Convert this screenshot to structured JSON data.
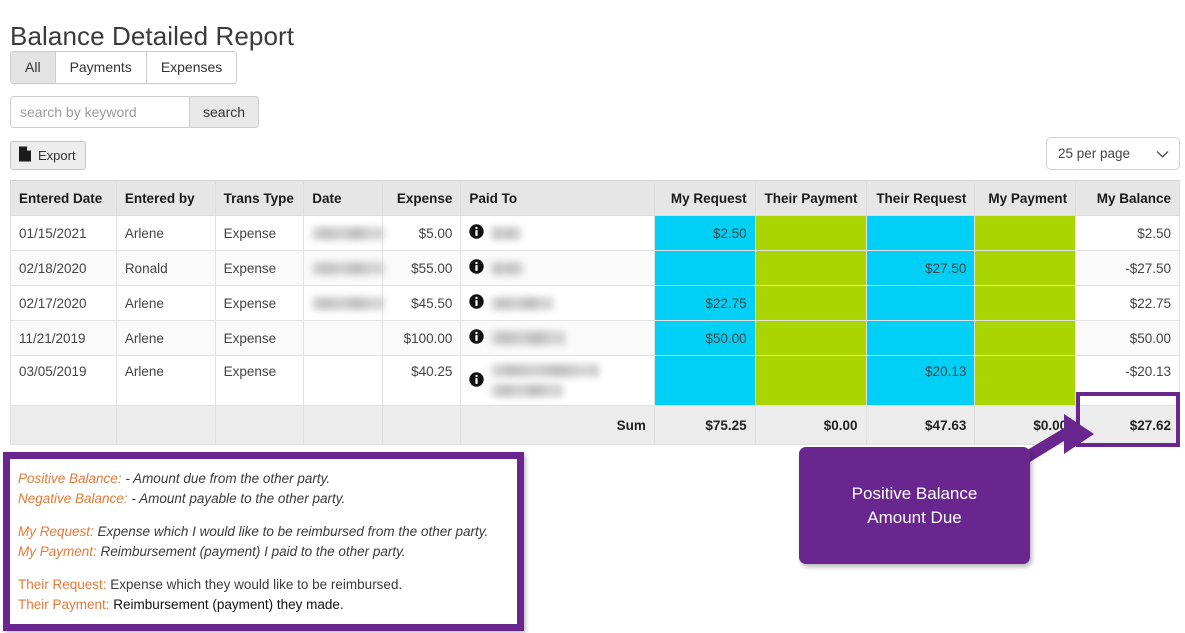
{
  "page": {
    "title": "Balance Detailed Report"
  },
  "tabs": [
    {
      "label": "All",
      "active": true
    },
    {
      "label": "Payments",
      "active": false
    },
    {
      "label": "Expenses",
      "active": false
    }
  ],
  "search": {
    "placeholder": "search by keyword",
    "value": "",
    "button_label": "search"
  },
  "toolbar": {
    "export_label": "Export",
    "export_icon": "document-icon"
  },
  "per_page": {
    "selected": "25 per page",
    "chevron_icon": "chevron-down-icon"
  },
  "table": {
    "columns": [
      {
        "key": "entered_date",
        "label": "Entered Date",
        "align": "left"
      },
      {
        "key": "entered_by",
        "label": "Entered by",
        "align": "left"
      },
      {
        "key": "trans_type",
        "label": "Trans Type",
        "align": "left"
      },
      {
        "key": "date",
        "label": "Date",
        "align": "left"
      },
      {
        "key": "expense",
        "label": "Expense",
        "align": "right"
      },
      {
        "key": "paid_to",
        "label": "Paid To",
        "align": "left"
      },
      {
        "key": "my_request",
        "label": "My Request",
        "align": "right"
      },
      {
        "key": "their_payment",
        "label": "Their Payment",
        "align": "right"
      },
      {
        "key": "their_request",
        "label": "Their Request",
        "align": "right"
      },
      {
        "key": "my_payment",
        "label": "My Payment",
        "align": "right"
      },
      {
        "key": "my_balance",
        "label": "My Balance",
        "align": "right"
      }
    ],
    "rows": [
      {
        "entered_date": "01/15/2021",
        "entered_by": "Arlene",
        "trans_type": "Expense",
        "date": "",
        "expense": "$5.00",
        "paid_to": "",
        "my_request": "$2.50",
        "their_payment": "",
        "their_request": "",
        "my_payment": "",
        "my_balance": "$2.50"
      },
      {
        "entered_date": "02/18/2020",
        "entered_by": "Ronald",
        "trans_type": "Expense",
        "date": "",
        "expense": "$55.00",
        "paid_to": "",
        "my_request": "",
        "their_payment": "",
        "their_request": "$27.50",
        "my_payment": "",
        "my_balance": "-$27.50"
      },
      {
        "entered_date": "02/17/2020",
        "entered_by": "Arlene",
        "trans_type": "Expense",
        "date": "",
        "expense": "$45.50",
        "paid_to": "",
        "my_request": "$22.75",
        "their_payment": "",
        "their_request": "",
        "my_payment": "",
        "my_balance": "$22.75"
      },
      {
        "entered_date": "11/21/2019",
        "entered_by": "Arlene",
        "trans_type": "Expense",
        "date": "",
        "expense": "$100.00",
        "paid_to": "",
        "my_request": "$50.00",
        "their_payment": "",
        "their_request": "",
        "my_payment": "",
        "my_balance": "$50.00"
      },
      {
        "entered_date": "03/05/2019",
        "entered_by": "Arlene",
        "trans_type": "Expense",
        "date": "",
        "expense": "$40.25",
        "paid_to": "",
        "my_request": "",
        "their_payment": "",
        "their_request": "$20.13",
        "my_payment": "",
        "my_balance": "-$20.13"
      }
    ],
    "sum_row": {
      "label": "Sum",
      "my_request": "$75.25",
      "their_payment": "$0.00",
      "their_request": "$47.63",
      "my_payment": "$0.00",
      "my_balance": "$27.62"
    }
  },
  "callout": {
    "line1": "Positive Balance",
    "line2": "Amount Due"
  },
  "legend": [
    {
      "label": "Positive Balance:",
      "text": " - Amount due from the other party.",
      "italic": true
    },
    {
      "label": "Negative Balance:",
      "text": " - Amount payable to the other party.",
      "italic": true
    },
    {
      "label": "My Request:",
      "text": " Expense which I would like to be reimbursed from the other party.",
      "italic": true
    },
    {
      "label": "My Payment:",
      "text": " Reimbursement (payment) I paid to the other party.",
      "italic": true
    },
    {
      "label": "Their Request:",
      "text": " Expense which they would like to be reimbursed.",
      "italic": false
    },
    {
      "label": "Their Payment:",
      "text": " Reimbursement (payment) they made.",
      "italic": false
    }
  ],
  "colors": {
    "request_cell": "#00d0f5",
    "payment_cell": "#aad500",
    "accent_purple": "#69268f",
    "legend_label": "#e07b39",
    "header_bg": "#e6e6e6"
  }
}
